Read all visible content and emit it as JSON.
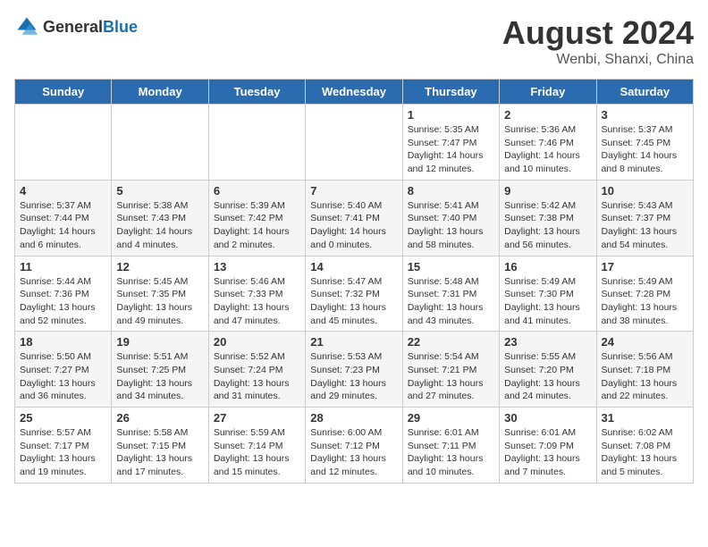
{
  "header": {
    "logo_general": "General",
    "logo_blue": "Blue",
    "title": "August 2024",
    "location": "Wenbi, Shanxi, China"
  },
  "weekdays": [
    "Sunday",
    "Monday",
    "Tuesday",
    "Wednesday",
    "Thursday",
    "Friday",
    "Saturday"
  ],
  "weeks": [
    [
      {
        "day": "",
        "info": ""
      },
      {
        "day": "",
        "info": ""
      },
      {
        "day": "",
        "info": ""
      },
      {
        "day": "",
        "info": ""
      },
      {
        "day": "1",
        "info": "Sunrise: 5:35 AM\nSunset: 7:47 PM\nDaylight: 14 hours\nand 12 minutes."
      },
      {
        "day": "2",
        "info": "Sunrise: 5:36 AM\nSunset: 7:46 PM\nDaylight: 14 hours\nand 10 minutes."
      },
      {
        "day": "3",
        "info": "Sunrise: 5:37 AM\nSunset: 7:45 PM\nDaylight: 14 hours\nand 8 minutes."
      }
    ],
    [
      {
        "day": "4",
        "info": "Sunrise: 5:37 AM\nSunset: 7:44 PM\nDaylight: 14 hours\nand 6 minutes."
      },
      {
        "day": "5",
        "info": "Sunrise: 5:38 AM\nSunset: 7:43 PM\nDaylight: 14 hours\nand 4 minutes."
      },
      {
        "day": "6",
        "info": "Sunrise: 5:39 AM\nSunset: 7:42 PM\nDaylight: 14 hours\nand 2 minutes."
      },
      {
        "day": "7",
        "info": "Sunrise: 5:40 AM\nSunset: 7:41 PM\nDaylight: 14 hours\nand 0 minutes."
      },
      {
        "day": "8",
        "info": "Sunrise: 5:41 AM\nSunset: 7:40 PM\nDaylight: 13 hours\nand 58 minutes."
      },
      {
        "day": "9",
        "info": "Sunrise: 5:42 AM\nSunset: 7:38 PM\nDaylight: 13 hours\nand 56 minutes."
      },
      {
        "day": "10",
        "info": "Sunrise: 5:43 AM\nSunset: 7:37 PM\nDaylight: 13 hours\nand 54 minutes."
      }
    ],
    [
      {
        "day": "11",
        "info": "Sunrise: 5:44 AM\nSunset: 7:36 PM\nDaylight: 13 hours\nand 52 minutes."
      },
      {
        "day": "12",
        "info": "Sunrise: 5:45 AM\nSunset: 7:35 PM\nDaylight: 13 hours\nand 49 minutes."
      },
      {
        "day": "13",
        "info": "Sunrise: 5:46 AM\nSunset: 7:33 PM\nDaylight: 13 hours\nand 47 minutes."
      },
      {
        "day": "14",
        "info": "Sunrise: 5:47 AM\nSunset: 7:32 PM\nDaylight: 13 hours\nand 45 minutes."
      },
      {
        "day": "15",
        "info": "Sunrise: 5:48 AM\nSunset: 7:31 PM\nDaylight: 13 hours\nand 43 minutes."
      },
      {
        "day": "16",
        "info": "Sunrise: 5:49 AM\nSunset: 7:30 PM\nDaylight: 13 hours\nand 41 minutes."
      },
      {
        "day": "17",
        "info": "Sunrise: 5:49 AM\nSunset: 7:28 PM\nDaylight: 13 hours\nand 38 minutes."
      }
    ],
    [
      {
        "day": "18",
        "info": "Sunrise: 5:50 AM\nSunset: 7:27 PM\nDaylight: 13 hours\nand 36 minutes."
      },
      {
        "day": "19",
        "info": "Sunrise: 5:51 AM\nSunset: 7:25 PM\nDaylight: 13 hours\nand 34 minutes."
      },
      {
        "day": "20",
        "info": "Sunrise: 5:52 AM\nSunset: 7:24 PM\nDaylight: 13 hours\nand 31 minutes."
      },
      {
        "day": "21",
        "info": "Sunrise: 5:53 AM\nSunset: 7:23 PM\nDaylight: 13 hours\nand 29 minutes."
      },
      {
        "day": "22",
        "info": "Sunrise: 5:54 AM\nSunset: 7:21 PM\nDaylight: 13 hours\nand 27 minutes."
      },
      {
        "day": "23",
        "info": "Sunrise: 5:55 AM\nSunset: 7:20 PM\nDaylight: 13 hours\nand 24 minutes."
      },
      {
        "day": "24",
        "info": "Sunrise: 5:56 AM\nSunset: 7:18 PM\nDaylight: 13 hours\nand 22 minutes."
      }
    ],
    [
      {
        "day": "25",
        "info": "Sunrise: 5:57 AM\nSunset: 7:17 PM\nDaylight: 13 hours\nand 19 minutes."
      },
      {
        "day": "26",
        "info": "Sunrise: 5:58 AM\nSunset: 7:15 PM\nDaylight: 13 hours\nand 17 minutes."
      },
      {
        "day": "27",
        "info": "Sunrise: 5:59 AM\nSunset: 7:14 PM\nDaylight: 13 hours\nand 15 minutes."
      },
      {
        "day": "28",
        "info": "Sunrise: 6:00 AM\nSunset: 7:12 PM\nDaylight: 13 hours\nand 12 minutes."
      },
      {
        "day": "29",
        "info": "Sunrise: 6:01 AM\nSunset: 7:11 PM\nDaylight: 13 hours\nand 10 minutes."
      },
      {
        "day": "30",
        "info": "Sunrise: 6:01 AM\nSunset: 7:09 PM\nDaylight: 13 hours\nand 7 minutes."
      },
      {
        "day": "31",
        "info": "Sunrise: 6:02 AM\nSunset: 7:08 PM\nDaylight: 13 hours\nand 5 minutes."
      }
    ]
  ]
}
